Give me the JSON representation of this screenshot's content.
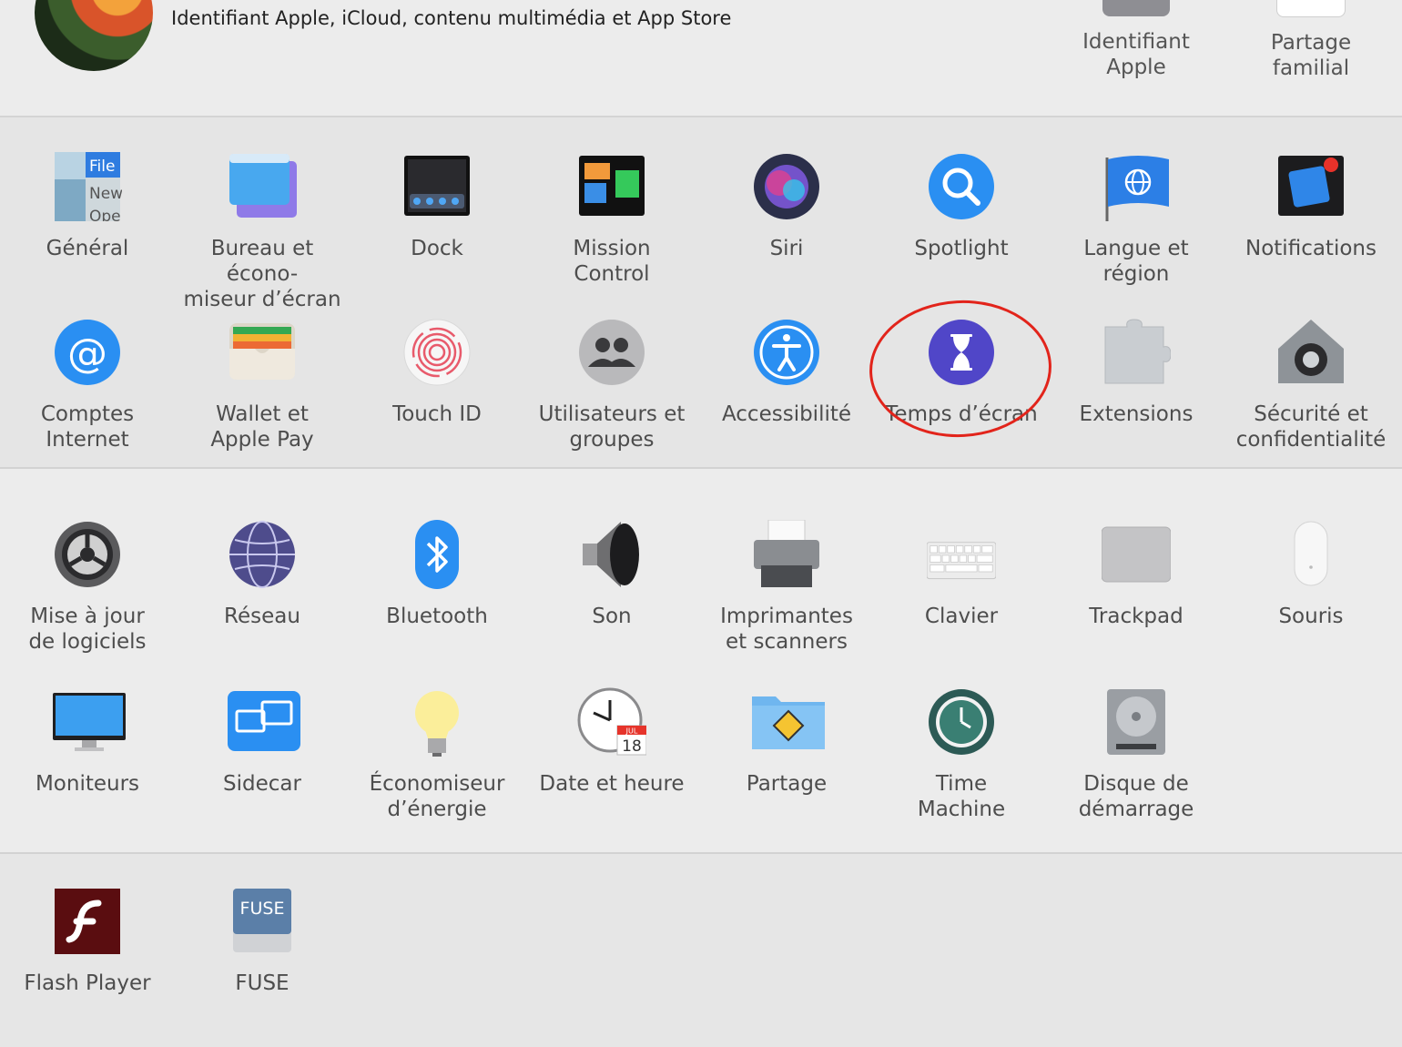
{
  "header": {
    "apple_account_subtitle": "Identifiant Apple, iCloud, contenu multimédia et App Store",
    "top_items": [
      {
        "label": "Identifiant\nApple",
        "icon": "apple-id-icon",
        "color": "#8e8e93"
      },
      {
        "label": "Partage\nfamilial",
        "icon": "family-sharing-icon",
        "color": "#ffffff"
      }
    ]
  },
  "section1": {
    "row1": [
      {
        "label": "Général",
        "icon": "general-icon"
      },
      {
        "label": "Bureau et écono-\nmiseur d’écran",
        "icon": "desktop-screensaver-icon"
      },
      {
        "label": "Dock",
        "icon": "dock-icon"
      },
      {
        "label": "Mission\nControl",
        "icon": "mission-control-icon"
      },
      {
        "label": "Siri",
        "icon": "siri-icon"
      },
      {
        "label": "Spotlight",
        "icon": "spotlight-icon"
      },
      {
        "label": "Langue et\nrégion",
        "icon": "language-region-icon"
      },
      {
        "label": "Notifications",
        "icon": "notifications-icon"
      }
    ],
    "row2": [
      {
        "label": "Comptes\nInternet",
        "icon": "internet-accounts-icon"
      },
      {
        "label": "Wallet et\nApple Pay",
        "icon": "wallet-icon"
      },
      {
        "label": "Touch ID",
        "icon": "touch-id-icon"
      },
      {
        "label": "Utilisateurs et\ngroupes",
        "icon": "users-groups-icon"
      },
      {
        "label": "Accessibilité",
        "icon": "accessibility-icon"
      },
      {
        "label": "Temps d’écran",
        "icon": "screen-time-icon"
      },
      {
        "label": "Extensions",
        "icon": "extensions-icon"
      },
      {
        "label": "Sécurité et\nconfidentialité",
        "icon": "security-privacy-icon"
      }
    ]
  },
  "section2": {
    "row1": [
      {
        "label": "Mise à jour\nde logiciels",
        "icon": "software-update-icon"
      },
      {
        "label": "Réseau",
        "icon": "network-icon"
      },
      {
        "label": "Bluetooth",
        "icon": "bluetooth-icon"
      },
      {
        "label": "Son",
        "icon": "sound-icon"
      },
      {
        "label": "Imprimantes\net scanners",
        "icon": "printers-scanners-icon"
      },
      {
        "label": "Clavier",
        "icon": "keyboard-icon"
      },
      {
        "label": "Trackpad",
        "icon": "trackpad-icon"
      },
      {
        "label": "Souris",
        "icon": "mouse-icon"
      }
    ],
    "row2": [
      {
        "label": "Moniteurs",
        "icon": "displays-icon"
      },
      {
        "label": "Sidecar",
        "icon": "sidecar-icon"
      },
      {
        "label": "Économiseur\nd’énergie",
        "icon": "energy-saver-icon"
      },
      {
        "label": "Date et heure",
        "icon": "date-time-icon"
      },
      {
        "label": "Partage",
        "icon": "sharing-icon"
      },
      {
        "label": "Time\nMachine",
        "icon": "time-machine-icon"
      },
      {
        "label": "Disque de\ndémarrage",
        "icon": "startup-disk-icon"
      }
    ]
  },
  "section3": {
    "row1": [
      {
        "label": "Flash Player",
        "icon": "flash-player-icon"
      },
      {
        "label": "FUSE",
        "icon": "fuse-icon"
      }
    ]
  },
  "icon_text": {
    "general_file": "File",
    "general_new": "New",
    "general_open": "Ope",
    "calendar_month": "JUL",
    "calendar_day": "18",
    "fuse_badge": "FUSE"
  },
  "annotation": {
    "highlight_color": "#e2241b"
  }
}
